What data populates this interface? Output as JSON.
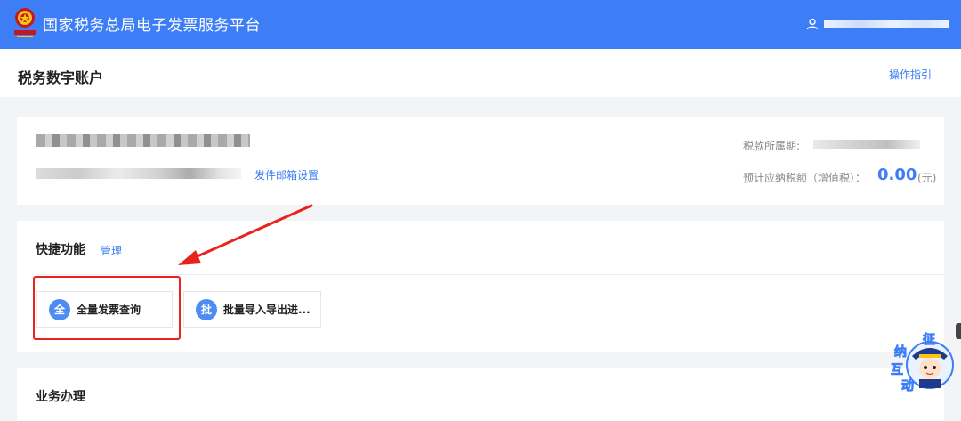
{
  "header": {
    "site_title": "国家税务总局电子发票服务平台",
    "brand_color": "#3d7ef6",
    "user_icon": "user-icon"
  },
  "subheader": {
    "page_title": "税务数字账户",
    "guide_link": "操作指引"
  },
  "account_info": {
    "mail_setting": "发件邮箱设置",
    "period_label": "税款所属期:",
    "tax_label": "预计应纳税额（增值税）：",
    "tax_amount": "0.00",
    "tax_unit": "(元)"
  },
  "quick_functions": {
    "title": "快捷功能",
    "manage_link": "管理",
    "items": [
      {
        "icon_text": "全",
        "label": "全量发票查询",
        "highlighted": true
      },
      {
        "icon_text": "批",
        "label": "批量导入导出进..."
      }
    ]
  },
  "business": {
    "title": "业务办理"
  },
  "badge": {
    "chars": [
      "征",
      "纳",
      "互",
      "动"
    ]
  },
  "annotation_color": "#e8221c"
}
